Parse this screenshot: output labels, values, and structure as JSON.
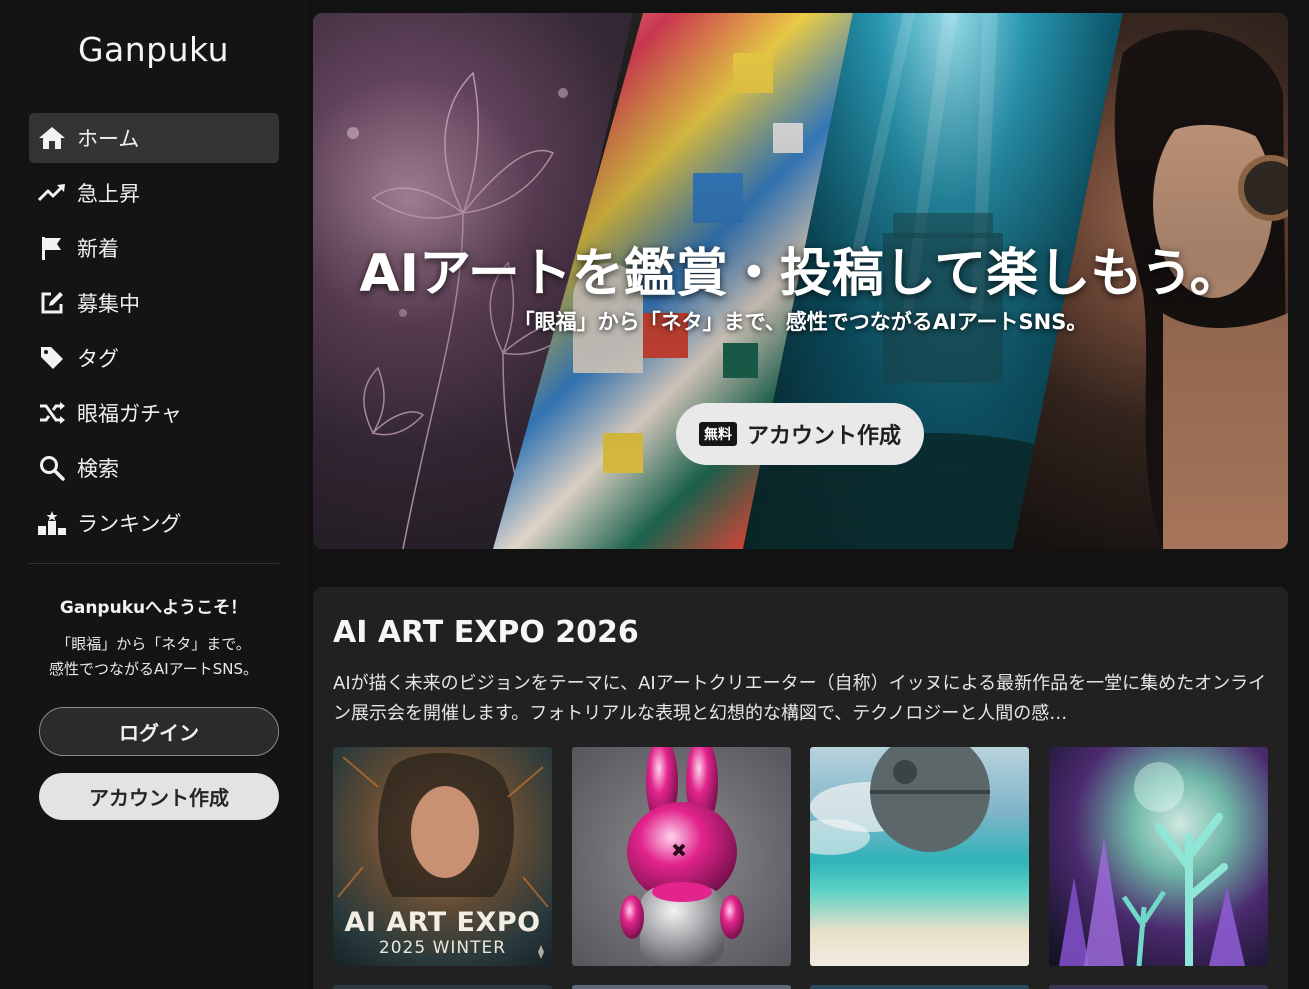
{
  "sidebar": {
    "logo": "Ganpuku",
    "nav": [
      {
        "label": "ホーム",
        "icon": "home-icon",
        "active": true
      },
      {
        "label": "急上昇",
        "icon": "trending-up-icon"
      },
      {
        "label": "新着",
        "icon": "flag-icon"
      },
      {
        "label": "募集中",
        "icon": "edit-icon"
      },
      {
        "label": "タグ",
        "icon": "tag-icon"
      },
      {
        "label": "眼福ガチャ",
        "icon": "shuffle-icon"
      },
      {
        "label": "検索",
        "icon": "search-icon"
      },
      {
        "label": "ランキング",
        "icon": "ranking-icon"
      }
    ],
    "welcome_title": "Ganpukuへようこそ！",
    "welcome_line1": "「眼福」から「ネタ」まで。",
    "welcome_line2": "感性でつながるAIアートSNS。",
    "login_label": "ログイン",
    "signup_label": "アカウント作成"
  },
  "hero": {
    "title": "AIアートを鑑賞・投稿して楽しもう。",
    "subtitle": "「眼福」から「ネタ」まで、感性でつながるAIアートSNS。",
    "badge": "無料",
    "button_label": "アカウント作成"
  },
  "expo": {
    "title": "AI ART EXPO 2026",
    "description": "AIが描く未来のビジョンをテーマに、AIアートクリエーター（自称）イッヌによる最新作品を一堂に集めたオンライン展示会を開催します。フォトリアルな表現と幻想的な構図で、テクノロジーと人間の感…",
    "thumb1_line1": "AI ART EXPO",
    "thumb1_line2": "2025 WINTER"
  },
  "colors": {
    "background": "#121212",
    "sidebar_active": "#343434",
    "card": "#212121",
    "button_light": "#e3e3e3"
  }
}
